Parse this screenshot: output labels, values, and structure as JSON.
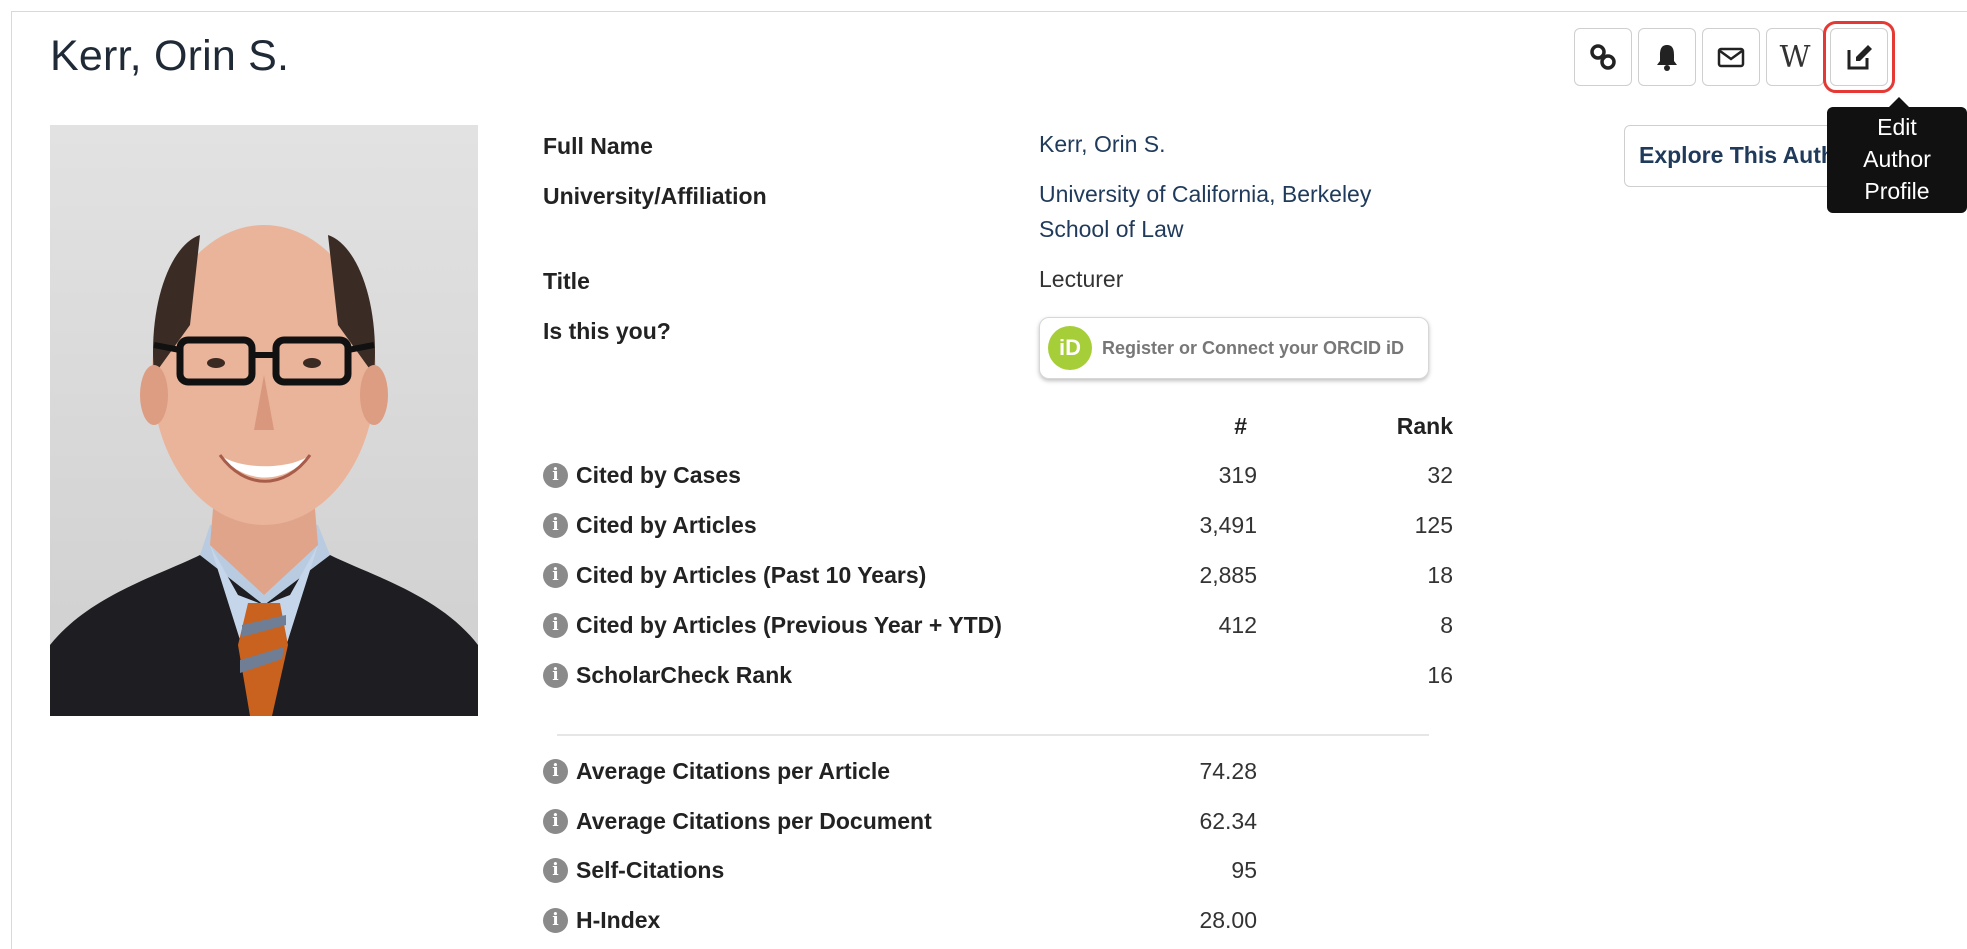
{
  "author": {
    "name": "Kerr, Orin S."
  },
  "toolbar": {
    "buttons": [
      {
        "icon": "link-icon"
      },
      {
        "icon": "bell-icon"
      },
      {
        "icon": "envelope-icon"
      },
      {
        "icon": "wikipedia-icon",
        "glyph": "W"
      },
      {
        "icon": "edit-icon"
      }
    ],
    "tooltip": {
      "line1": "Edit",
      "line2": "Author",
      "line3": "Profile"
    }
  },
  "explore_button": {
    "label": "Explore This Author"
  },
  "profile": {
    "full_name_label": "Full Name",
    "full_name_value": "Kerr, Orin S.",
    "affiliation_label": "University/Affiliation",
    "affiliation_line1": "University of California, Berkeley",
    "affiliation_line2": "School of Law",
    "title_label": "Title",
    "title_value": "Lecturer",
    "is_this_you_label": "Is this you?",
    "orcid_logo_text": "iD",
    "orcid_button_text": "Register or Connect your ORCID iD"
  },
  "metrics": {
    "count_header": "#",
    "rank_header": "Rank",
    "ranked": [
      {
        "label": "Cited by Cases",
        "count": "319",
        "rank": "32"
      },
      {
        "label": "Cited by Articles",
        "count": "3,491",
        "rank": "125"
      },
      {
        "label": "Cited by Articles (Past 10 Years)",
        "count": "2,885",
        "rank": "18"
      },
      {
        "label": "Cited by Articles (Previous Year + YTD)",
        "count": "412",
        "rank": "8"
      },
      {
        "label": "ScholarCheck Rank",
        "count": "",
        "rank": "16"
      }
    ],
    "averages": [
      {
        "label": "Average Citations per Article",
        "count": "74.28"
      },
      {
        "label": "Average Citations per Document",
        "count": "62.34"
      },
      {
        "label": "Self-Citations",
        "count": "95"
      },
      {
        "label": "H-Index",
        "count": "28.00"
      }
    ]
  },
  "colors": {
    "highlight": "#e53935",
    "orcid": "#a6ce39",
    "link": "#1f3a5a"
  }
}
